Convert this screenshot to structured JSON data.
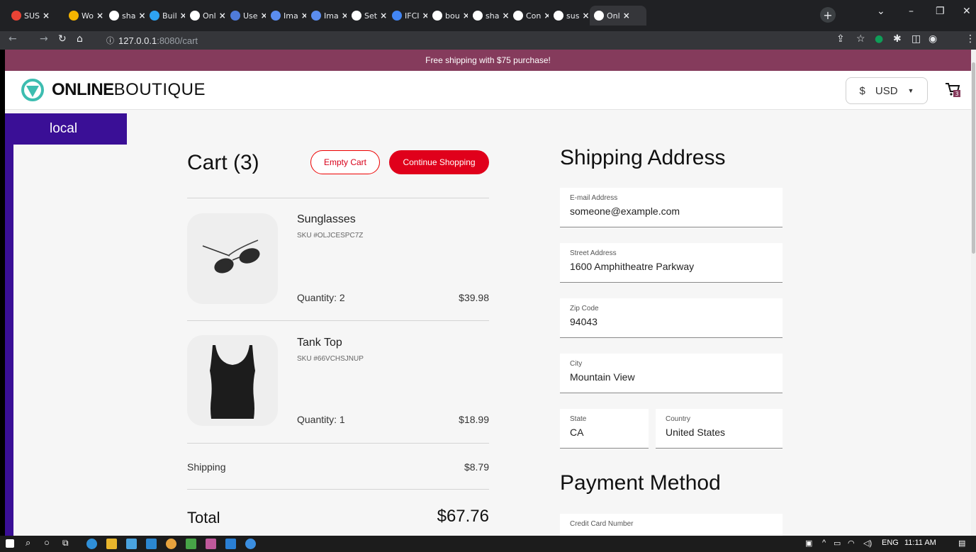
{
  "browser": {
    "tabs": [
      {
        "label": "SUS",
        "color": "#ea4335"
      },
      {
        "label": "Wo",
        "color": "#f4b400"
      },
      {
        "label": "sha",
        "color": "#ffffff"
      },
      {
        "label": "Buil",
        "color": "#2ea3f2"
      },
      {
        "label": "Onl",
        "color": "#ffffff"
      },
      {
        "label": "Use",
        "color": "#4f7bd9"
      },
      {
        "label": "Ima",
        "color": "#5b8def"
      },
      {
        "label": "Ima",
        "color": "#5b8def"
      },
      {
        "label": "Set",
        "color": "#ffffff"
      },
      {
        "label": "IFCI",
        "color": "#4285f4"
      },
      {
        "label": "bou",
        "color": "#ffffff"
      },
      {
        "label": "sha",
        "color": "#ffffff"
      },
      {
        "label": "Con",
        "color": "#ffffff"
      },
      {
        "label": "sus",
        "color": "#ffffff"
      },
      {
        "label": "Onl",
        "color": "#ffffff"
      }
    ],
    "new_tab": "+",
    "url_host": "127.0.0.1",
    "url_path": ":8080/cart"
  },
  "promo_text": "Free shipping with $75 purchase!",
  "header": {
    "logo_bold": "ONLINE",
    "logo_light": "BOUTIQUE",
    "currency_symbol": "$",
    "currency_code": "USD",
    "cart_count": "3"
  },
  "env_label": "local",
  "cart": {
    "title": "Cart (3)",
    "empty_label": "Empty Cart",
    "continue_label": "Continue Shopping",
    "items": [
      {
        "name": "Sunglasses",
        "sku": "SKU #OLJCESPC7Z",
        "quantity": "Quantity: 2",
        "price": "$39.98"
      },
      {
        "name": "Tank Top",
        "sku": "SKU #66VCHSJNUP",
        "quantity": "Quantity: 1",
        "price": "$18.99"
      }
    ],
    "shipping_label": "Shipping",
    "shipping_value": "$8.79",
    "total_label": "Total",
    "total_value": "$67.76"
  },
  "shipping_form": {
    "title": "Shipping Address",
    "email": {
      "label": "E-mail Address",
      "value": "someone@example.com"
    },
    "street": {
      "label": "Street Address",
      "value": "1600 Amphitheatre Parkway"
    },
    "zip": {
      "label": "Zip Code",
      "value": "94043"
    },
    "city": {
      "label": "City",
      "value": "Mountain View"
    },
    "state": {
      "label": "State",
      "value": "CA"
    },
    "country": {
      "label": "Country",
      "value": "United States"
    }
  },
  "payment": {
    "title": "Payment Method",
    "card_label": "Credit Card Number"
  },
  "taskbar": {
    "lang": "ENG",
    "time": "11:11 AM"
  },
  "colors": {
    "promo": "#853b5c",
    "accent": "#e0001b",
    "env": "#3a0f96",
    "logo": "#3dbdb0"
  }
}
